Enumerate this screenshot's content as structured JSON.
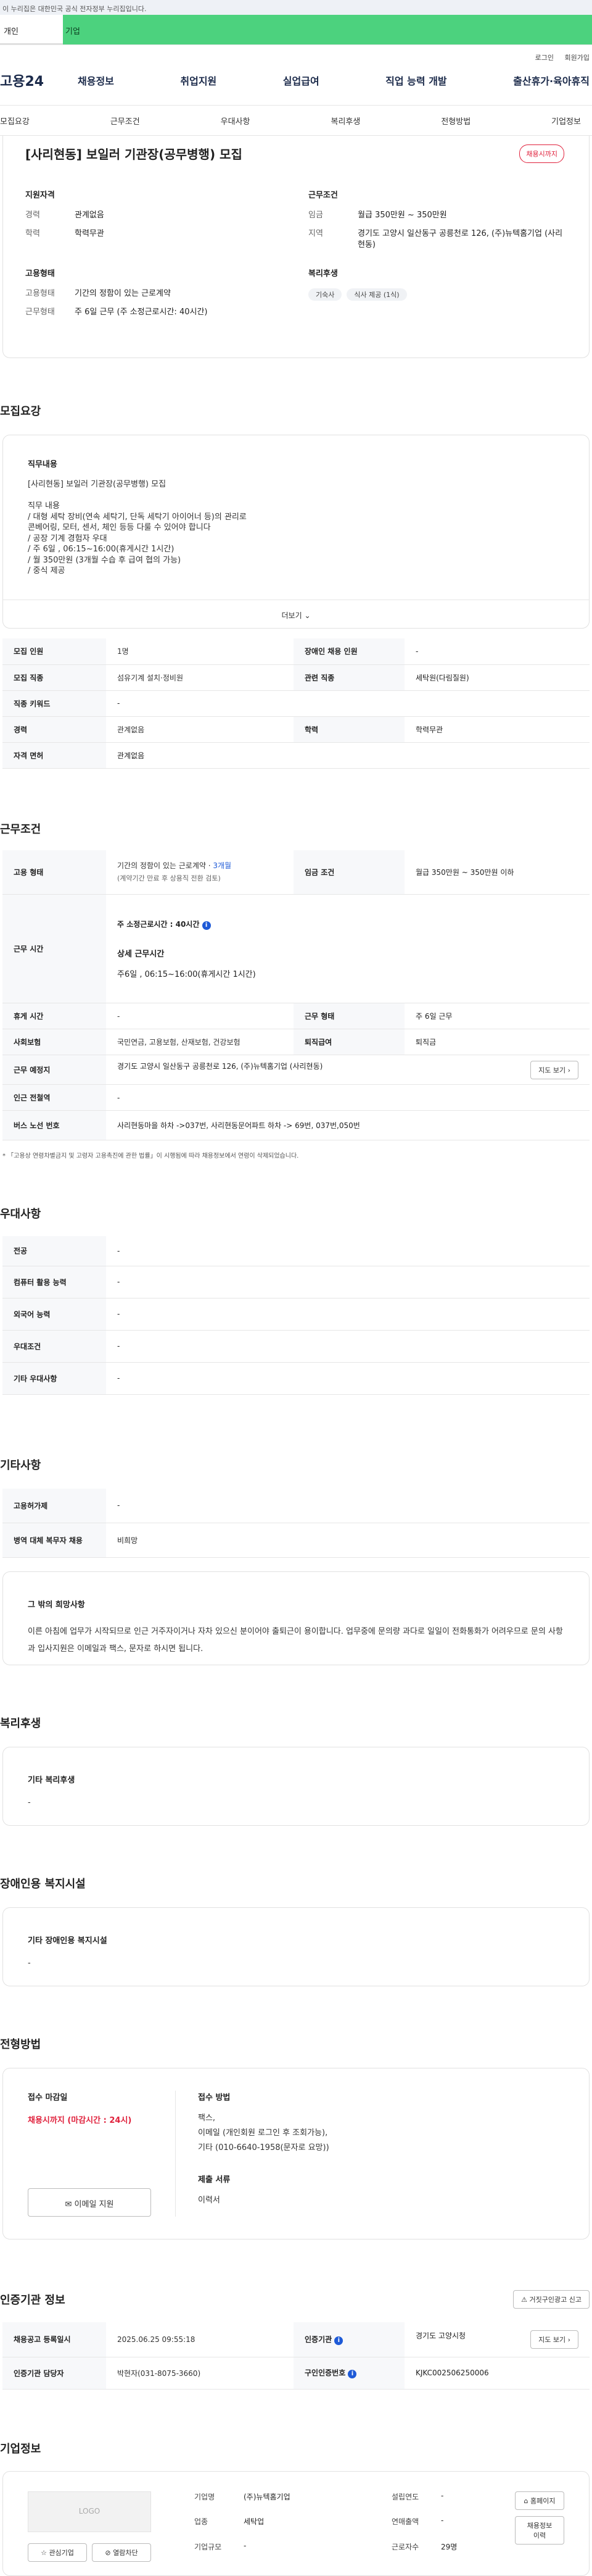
{
  "gov_banner": "이 누리집은 대한민국 공식 전자정부 누리집입니다.",
  "top_tabs": {
    "person": "개인",
    "business": "기업"
  },
  "util_links": {
    "login": "로그인",
    "join": "회원가입"
  },
  "logo": "고용24",
  "gnb": [
    "채용정보",
    "취업지원",
    "실업급여",
    "직업 능력 개발",
    "출산휴가·육아휴직"
  ],
  "anchors": [
    "모집요강",
    "근무조건",
    "우대사항",
    "복리후생",
    "전형방법",
    "기업정보"
  ],
  "summary": {
    "title": "[사리현동] 보일러 기관장(공무병행) 모집",
    "status": "채용시까지",
    "qual": {
      "heading": "지원자격",
      "career_k": "경력",
      "career_v": "관계없음",
      "edu_k": "학력",
      "edu_v": "학력무관"
    },
    "cond": {
      "heading": "근무조건",
      "wage_k": "임금",
      "wage_v": "월급 350만원 ~ 350만원",
      "loc_k": "지역",
      "loc_v": "경기도 고양시 일산동구 공릉천로 126, (주)뉴텍홈기업 (사리현동)"
    },
    "emp": {
      "heading": "고용형태",
      "type_k": "고용형태",
      "type_v": "기간의 정함이 있는 근로계약",
      "hours_k": "근무형태",
      "hours_v": "주 6일 근무 (주 소정근로시간: 40시간)"
    },
    "welfare": {
      "heading": "복리후생",
      "chips": [
        "기숙사",
        "식사 제공 (1식)"
      ]
    }
  },
  "recruit": {
    "heading": "모집요강",
    "duty_heading": "직무내용",
    "duty_text": "[사리현동] 보일러 기관장(공무병행) 모집\n\n직무 내용\n/ 대형 세탁 장비(연속 세탁기, 단독 세탁기 아이어너 등)의 관리로\n  콘베어링, 모터, 센서, 체인 등등 다룰 수 있어야 합니다\n/ 공장 기계 경험자 우대\n/ 주 6일 , 06:15~16:00(휴게시간 1시간)\n/ 월 350만원 (3개월 수습 후 급여 협의 가능)\n/ 중식 제공",
    "more": "더보기",
    "rows": [
      {
        "k1": "모집 인원",
        "v1": "1명",
        "k2": "장애인 채용 인원",
        "v2": "-"
      },
      {
        "k1": "모집 직종",
        "v1": "섬유기계 설치·정비원",
        "k2": "관련 직종",
        "v2": "세탁원(다림질원)"
      },
      {
        "k1": "직종 키워드",
        "v1": "-",
        "k2": "",
        "v2": ""
      },
      {
        "k1": "경력",
        "v1": "관계없음",
        "k2": "학력",
        "v2": "학력무관"
      },
      {
        "k1": "자격 면허",
        "v1": "관계없음",
        "k2": "",
        "v2": ""
      }
    ]
  },
  "work": {
    "heading": "근무조건",
    "emp_k": "고용 형태",
    "emp_v": "기간의 정함이 있는 근로계약 · ",
    "emp_months": "3개월",
    "emp_note": "(계약기간 만료 후 상용직 전환 검토)",
    "wage_k": "임금 조건",
    "wage_v": "월급 350만원 ~ 350만원 이하",
    "time_k": "근무 시간",
    "time_weekly": "주 소정근로시간 : 40시간",
    "time_detail_h": "상세 근무시간",
    "time_detail_v": "주6일 , 06:15~16:00(휴게시간 1시간)",
    "rest_k": "휴게 시간",
    "rest_v": "-",
    "type_k": "근무 형태",
    "type_v": "주 6일 근무",
    "ins_k": "사회보험",
    "ins_v": "국민연금, 고용보험, 산재보험, 건강보험",
    "sev_k": "퇴직급여",
    "sev_v": "퇴직금",
    "place_k": "근무 예정지",
    "place_v": "경기도 고양시 일산동구 공릉천로 126, (주)뉴텍홈기업 (사리현동)",
    "map_btn": "지도 보기",
    "sub_k": "인근 전철역",
    "sub_v": "-",
    "bus_k": "버스 노선 번호",
    "bus_v": "사리현동마을 하차 ->037번, 사리현동문어파트 하차 -> 69번, 037번,050번",
    "note": "* 「고용상 연령차별금지 및 고령자 고용촉진에 관한 법률」이 시행됨에 따라 채용정보에서 연령이 삭제되었습니다."
  },
  "pref": {
    "heading": "우대사항",
    "rows": [
      {
        "k": "전공",
        "v": "-"
      },
      {
        "k": "컴퓨터 활용 능력",
        "v": "-"
      },
      {
        "k": "외국어 능력",
        "v": "-"
      },
      {
        "k": "우대조건",
        "v": "-"
      },
      {
        "k": "기타 우대사항",
        "v": "-"
      }
    ]
  },
  "etc": {
    "heading": "기타사항",
    "rows": [
      {
        "k": "고용허가제",
        "v": "-"
      },
      {
        "k": "병역 대체 복무자 채용",
        "v": "비희망"
      }
    ],
    "other_h": "그 밖의 희망사항",
    "other_v": "이른 아침에 업무가 시작되므로 인근 거주자이거나 자차 있으신 분이어야 출퇴근이 용이합니다. 업무중에 문의량 과다로 일일이 전화통화가 어려우므로 문의 사항과 입사지원은 이메일과 팩스, 문자로 하시면 됩니다."
  },
  "benefits": {
    "heading": "복리후생",
    "sub": "기타 복리후생",
    "val": "-"
  },
  "disabled": {
    "heading": "장애인용 복지시설",
    "sub": "기타 장애인용 복지시설",
    "val": "-"
  },
  "screen": {
    "heading": "전형방법",
    "deadline_h": "접수 마감일",
    "deadline_v": "채용시까지 (마감시간 : 24시)",
    "email_btn": "이메일 지원",
    "method_h": "접수 방법",
    "method_v": "팩스,\n이메일 (개인회원 로그인 후 조회가능),\n기타 (010-6640-1958(문자로 요망))",
    "docs_h": "제출 서류",
    "docs_v": "이력서"
  },
  "cert": {
    "heading": "인증기관 정보",
    "report_btn": "거짓구인광고 신고",
    "reg_k": "채용공고 등록일시",
    "reg_v": "2025.06.25 09:55:18",
    "org_k": "인증기관",
    "org_v": "경기도 고양시청",
    "map_btn": "지도 보기",
    "mgr_k": "인증기관 담당자",
    "mgr_v": "박현자(031-8075-3660)",
    "no_k": "구인인증번호",
    "no_v": "KJKC002506250006"
  },
  "company": {
    "heading": "기업정보",
    "logo": "LOGO",
    "fav_btn": "관심기업",
    "block_btn": "열람차단",
    "name_k": "기업명",
    "name_v": "(주)뉴텍홈기업",
    "ind_k": "업종",
    "ind_v": "세탁업",
    "size_k": "기업규모",
    "size_v": "-",
    "year_k": "설립연도",
    "year_v": "-",
    "sales_k": "연매출액",
    "sales_v": "-",
    "emp_k": "근로자수",
    "emp_v": "29명",
    "home_btn": "홈페이지",
    "jobs_btn": "채용정보 이력"
  }
}
